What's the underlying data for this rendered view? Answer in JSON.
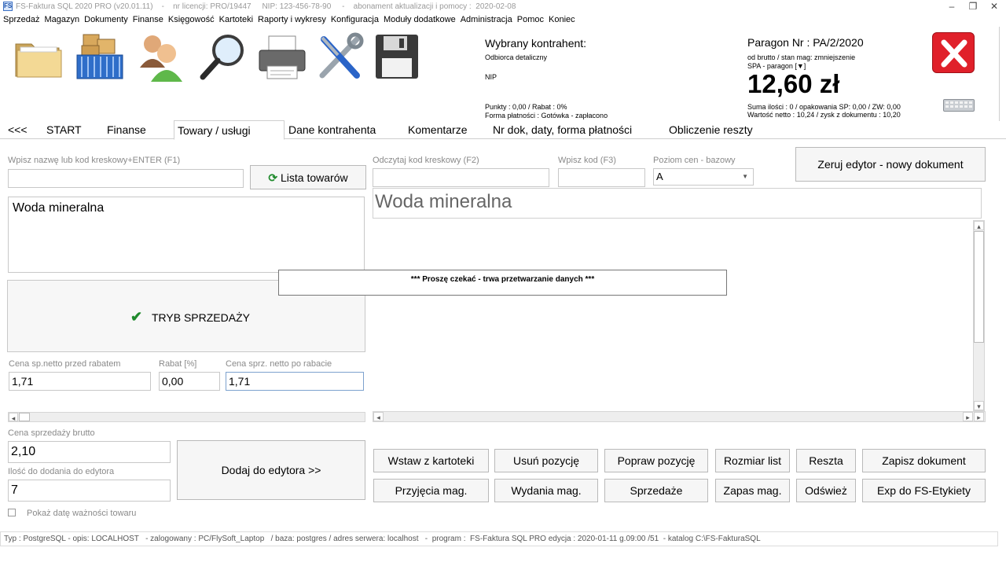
{
  "titlebar": {
    "text": "FS-Faktura SQL 2020 PRO (v20.01.11)    -    nr licencji: PRO/19447     NIP: 123-456-78-90     -    abonament aktualizacji i pomocy :  2020-02-08",
    "logo": "FS"
  },
  "menu": [
    "Sprzedaż",
    "Magazyn",
    "Dokumenty",
    "Finanse",
    "Księgowość",
    "Kartoteki",
    "Raporty i wykresy",
    "Konfiguracja",
    "Moduły dodatkowe",
    "Administracja",
    "Pomoc",
    "Koniec"
  ],
  "toolbar_icons": [
    "folder-icon",
    "warehouse-boxes-icon",
    "contacts-icon",
    "magnifier-icon",
    "printer-icon",
    "tools-icon",
    "floppy-disk-icon"
  ],
  "contractor": {
    "heading": "Wybrany kontrahent:",
    "name": "Odbiorca detaliczny",
    "nip": "NIP",
    "points": "Punkty : 0,00 / Rabat : 0%",
    "payment": "Forma płatności : Gotówka - zapłacono"
  },
  "receipt": {
    "title": "Paragon Nr :  PA/2/2020",
    "sub1": "od brutto / stan mag: zmniejszenie",
    "sub2": "SPA - paragon [▼]",
    "amount": "12,60 zł",
    "sum1": "Suma ilości : 0 / opakowania SP: 0,00 / ZW: 0,00",
    "sum2": "Wartość netto : 10,24  /  zysk z dokumentu : 10,20"
  },
  "tabs": [
    "<<<",
    "START",
    "Finanse",
    "Towary  / usługi",
    "Dane kontrahenta",
    "Komentarze",
    "Nr dok, daty, forma płatności",
    "Obliczenie reszty"
  ],
  "left": {
    "search_label": "Wpisz nazwę lub kod kreskowy+ENTER (F1)",
    "search_value": "",
    "list_button": "Lista towarów",
    "product_name": "Woda mineralna",
    "mode": "TRYB SPRZEDAŻY",
    "net_price_label": "Cena sp.netto przed rabatem",
    "net_price": "1,71",
    "discount_label": "Rabat [%]",
    "discount": "0,00",
    "net_after_label": "Cena sprz. netto po rabacie",
    "net_after": "1,71",
    "gross_label": "Cena sprzedaży brutto",
    "gross": "2,10",
    "qty_label": "Ilość do dodania do edytora",
    "qty": "7",
    "add_button": "Dodaj do edytora     >>",
    "expiry_label": "Pokaż datę ważności towaru"
  },
  "right": {
    "barcode_label": "Odczytaj kod kreskowy (F2)",
    "code_label": "Wpisz kod (F3)",
    "price_level_label": "Poziom cen - bazowy",
    "price_level": "A",
    "reset_button": "Zeruj edytor -  nowy dokument",
    "product_display": "Woda mineralna"
  },
  "processing": "***   Proszę czekać -  trwa przetwarzanie danych  ***",
  "buttons_row1": [
    "Wstaw z kartoteki",
    "Usuń pozycję",
    "Popraw pozycję",
    "Rozmiar list",
    "Reszta",
    "Zapisz dokument"
  ],
  "buttons_row2": [
    "Przyjęcia mag.",
    "Wydania mag.",
    "Sprzedaże",
    "Zapas mag.",
    "Odśwież",
    "Exp do FS-Etykiety"
  ],
  "status": "Typ : PostgreSQL - opis: LOCALHOST   - zalogowany : PC/FlySoft_Laptop   / baza: postgres / adres serwera: localhost   -  program :  FS-Faktura SQL PRO edycja : 2020-01-11 g.09:00 /51  - katalog C:\\FS-FakturaSQL",
  "colors": {
    "close_red": "#e0202a",
    "check_green": "#1f8a2c",
    "border_gray": "#c8c8c8"
  }
}
